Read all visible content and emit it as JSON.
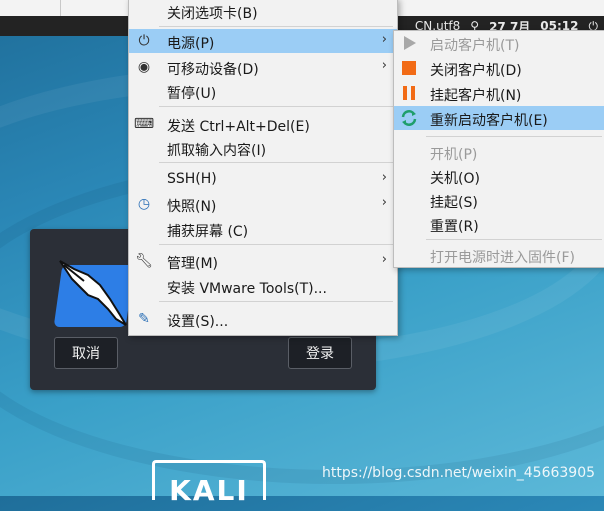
{
  "topbar": {
    "lang": "CN.utf8",
    "date": "27 7月",
    "time": "05:12"
  },
  "main_menu": {
    "items": [
      {
        "label": "关闭选项卡(B)"
      },
      {
        "label": "电源(P)"
      },
      {
        "label": "可移动设备(D)"
      },
      {
        "label": "暂停(U)"
      },
      {
        "label": "发送 Ctrl+Alt+Del(E)"
      },
      {
        "label": "抓取输入内容(I)"
      },
      {
        "label": "SSH(H)"
      },
      {
        "label": "快照(N)"
      },
      {
        "label": "捕获屏幕 (C)"
      },
      {
        "label": "管理(M)"
      },
      {
        "label": "安装 VMware Tools(T)..."
      },
      {
        "label": "设置(S)..."
      }
    ]
  },
  "power_menu": {
    "items": [
      {
        "label": "启动客户机(T)"
      },
      {
        "label": "关闭客户机(D)"
      },
      {
        "label": "挂起客户机(N)"
      },
      {
        "label": "重新启动客户机(E)"
      },
      {
        "label": "开机(P)"
      },
      {
        "label": "关机(O)"
      },
      {
        "label": "挂起(S)"
      },
      {
        "label": "重置(R)"
      },
      {
        "label": "打开电源时进入固件(F)"
      }
    ]
  },
  "login": {
    "cancel": "取消",
    "submit": "登录"
  },
  "desktop": {
    "brand": "KALI"
  },
  "watermark": "https://blog.csdn.net/weixin_45663905",
  "colors": {
    "highlight": "#9bcdf5",
    "stop_icon": "#f26b16",
    "pause_icon": "#f26b16",
    "restart_icon": "#1f9e6b"
  }
}
